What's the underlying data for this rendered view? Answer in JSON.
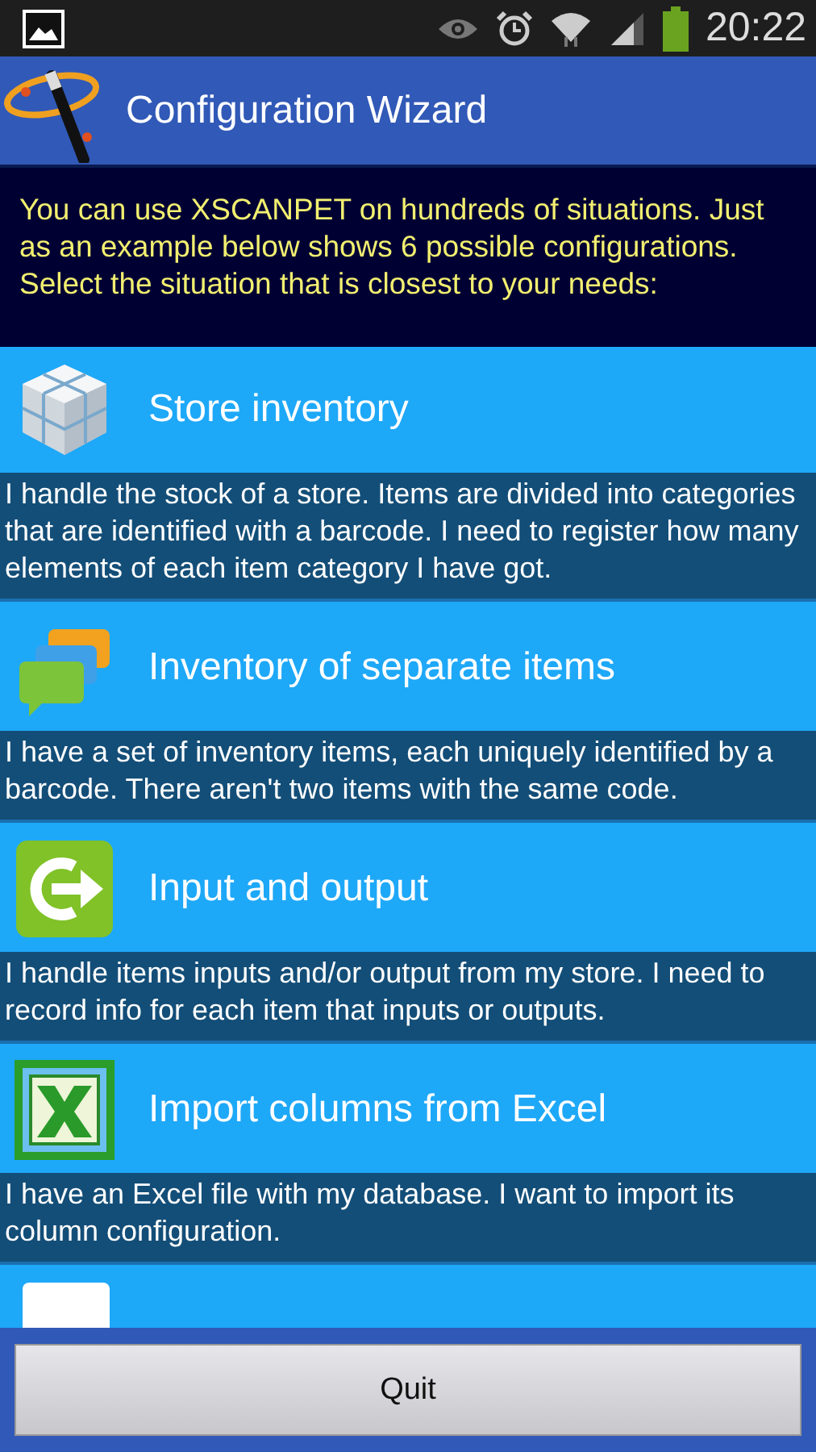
{
  "status_bar": {
    "time": "20:22"
  },
  "header": {
    "title": "Configuration Wizard"
  },
  "intro": "You can use XSCANPET on hundreds of situations. Just as an example below shows 6 possible configurations. Select the situation that is closest to your needs:",
  "options": [
    {
      "kind": "cubes",
      "title": "Store inventory",
      "description": "I handle the stock of a store. Items are divided into categories that are identified with a barcode. I need to register how many elements of each item category I have got."
    },
    {
      "kind": "bubbles",
      "title": "Inventory of separate items",
      "description": "I have a set of inventory items, each uniquely identified by a barcode. There aren't two items with the same code."
    },
    {
      "kind": "exit",
      "title": "Input and output",
      "description": "I handle items inputs and/or output from my store. I need to record info for each item that inputs or outputs."
    },
    {
      "kind": "excel",
      "title": "Import columns from Excel",
      "description": "I have an Excel file with my database. I want to import its column configuration."
    },
    {
      "kind": "blank"
    }
  ],
  "buttons": [
    "Quit"
  ]
}
